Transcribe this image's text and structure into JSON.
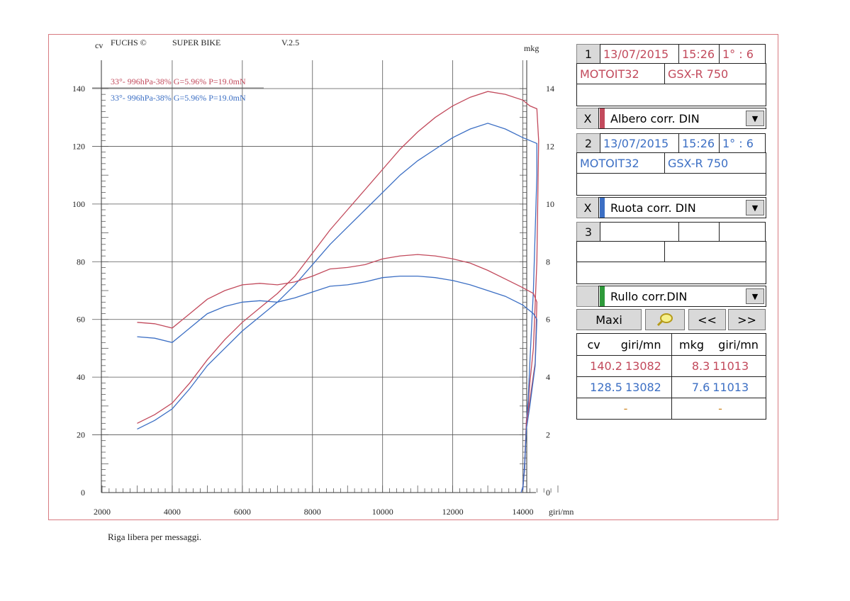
{
  "header": {
    "cv_unit": "cv",
    "brand": "FUCHS ©",
    "program": "SUPER BIKE",
    "version": "V.2.5",
    "right_unit": "mkg"
  },
  "chart_data": {
    "type": "line",
    "xlabel": "giri/mn",
    "ylabel": "cv",
    "y2label": "mkg",
    "xlim": [
      2000,
      15000
    ],
    "ylim": [
      0,
      140
    ],
    "y2lim": [
      0,
      14
    ],
    "x_ticks": [
      "2000",
      "4000",
      "6000",
      "8000",
      "10000",
      "12000",
      "14000"
    ],
    "y_ticks": [
      "0",
      "20",
      "40",
      "60",
      "80",
      "100",
      "120",
      "140"
    ],
    "y2_ticks": [
      "0",
      "2",
      "4",
      "6",
      "8",
      "10",
      "12",
      "14"
    ],
    "grid": true,
    "legend": [
      {
        "label": "33°- 996hPa-38% G=5.96% P=19.0mN",
        "color": "#c24a5c"
      },
      {
        "label": "33°- 996hPa-38% G=5.96% P=19.0mN",
        "color": "#3c6fc4"
      }
    ],
    "series": [
      {
        "color": "#c24a5c",
        "quantity": "cv",
        "axis": "left",
        "points": [
          [
            3000,
            24
          ],
          [
            3500,
            27
          ],
          [
            4000,
            31
          ],
          [
            4500,
            38
          ],
          [
            5000,
            46
          ],
          [
            5500,
            53
          ],
          [
            6000,
            59
          ],
          [
            6500,
            64
          ],
          [
            7000,
            69
          ],
          [
            7500,
            75
          ],
          [
            8000,
            83
          ],
          [
            8500,
            91
          ],
          [
            9000,
            98
          ],
          [
            9500,
            105
          ],
          [
            10000,
            112
          ],
          [
            10500,
            119
          ],
          [
            11000,
            125
          ],
          [
            11500,
            130
          ],
          [
            12000,
            134
          ],
          [
            12500,
            137
          ],
          [
            13000,
            139
          ],
          [
            13500,
            138
          ],
          [
            14000,
            136
          ],
          [
            14200,
            134
          ],
          [
            14400,
            133
          ],
          [
            14450,
            122
          ],
          [
            14400,
            80
          ],
          [
            14300,
            50
          ],
          [
            14200,
            38
          ],
          [
            14150,
            30
          ],
          [
            14100,
            25
          ],
          [
            14050,
            8
          ],
          [
            14000,
            2
          ],
          [
            13950,
            0
          ]
        ]
      },
      {
        "color": "#3c6fc4",
        "quantity": "cv",
        "axis": "left",
        "points": [
          [
            3000,
            22
          ],
          [
            3500,
            25
          ],
          [
            4000,
            29
          ],
          [
            4500,
            36
          ],
          [
            5000,
            44
          ],
          [
            5500,
            50
          ],
          [
            6000,
            56
          ],
          [
            6500,
            61
          ],
          [
            7000,
            66
          ],
          [
            7500,
            72
          ],
          [
            8000,
            79
          ],
          [
            8500,
            86
          ],
          [
            9000,
            92
          ],
          [
            9500,
            98
          ],
          [
            10000,
            104
          ],
          [
            10500,
            110
          ],
          [
            11000,
            115
          ],
          [
            11500,
            119
          ],
          [
            12000,
            123
          ],
          [
            12500,
            126
          ],
          [
            13000,
            128
          ],
          [
            13500,
            126
          ],
          [
            14000,
            123
          ],
          [
            14200,
            122
          ],
          [
            14400,
            121
          ],
          [
            14400,
            110
          ],
          [
            14300,
            70
          ],
          [
            14200,
            45
          ],
          [
            14150,
            32
          ],
          [
            14100,
            24
          ],
          [
            14050,
            8
          ],
          [
            14000,
            2
          ],
          [
            13950,
            0
          ]
        ]
      },
      {
        "color": "#c24a5c",
        "quantity": "mkg",
        "axis": "right",
        "points": [
          [
            3000,
            5.9
          ],
          [
            3500,
            5.85
          ],
          [
            4000,
            5.7
          ],
          [
            4500,
            6.2
          ],
          [
            5000,
            6.7
          ],
          [
            5500,
            7.0
          ],
          [
            6000,
            7.2
          ],
          [
            6500,
            7.25
          ],
          [
            7000,
            7.2
          ],
          [
            7500,
            7.3
          ],
          [
            8000,
            7.5
          ],
          [
            8500,
            7.75
          ],
          [
            9000,
            7.8
          ],
          [
            9500,
            7.9
          ],
          [
            10000,
            8.1
          ],
          [
            10500,
            8.2
          ],
          [
            11000,
            8.25
          ],
          [
            11500,
            8.2
          ],
          [
            12000,
            8.1
          ],
          [
            12500,
            7.95
          ],
          [
            13000,
            7.7
          ],
          [
            13500,
            7.4
          ],
          [
            14000,
            7.1
          ],
          [
            14300,
            6.9
          ],
          [
            14400,
            6.6
          ],
          [
            14350,
            4.5
          ],
          [
            14200,
            3.2
          ],
          [
            14100,
            2.4
          ],
          [
            14050,
            1.0
          ],
          [
            14000,
            0.1
          ]
        ]
      },
      {
        "color": "#3c6fc4",
        "quantity": "mkg",
        "axis": "right",
        "points": [
          [
            3000,
            5.4
          ],
          [
            3500,
            5.35
          ],
          [
            4000,
            5.2
          ],
          [
            4500,
            5.7
          ],
          [
            5000,
            6.2
          ],
          [
            5500,
            6.45
          ],
          [
            6000,
            6.6
          ],
          [
            6500,
            6.65
          ],
          [
            7000,
            6.6
          ],
          [
            7500,
            6.75
          ],
          [
            8000,
            6.95
          ],
          [
            8500,
            7.15
          ],
          [
            9000,
            7.2
          ],
          [
            9500,
            7.3
          ],
          [
            10000,
            7.45
          ],
          [
            10500,
            7.5
          ],
          [
            11000,
            7.5
          ],
          [
            11500,
            7.45
          ],
          [
            12000,
            7.35
          ],
          [
            12500,
            7.2
          ],
          [
            13000,
            7.0
          ],
          [
            13500,
            6.8
          ],
          [
            14000,
            6.5
          ],
          [
            14300,
            6.2
          ],
          [
            14400,
            6.0
          ],
          [
            14350,
            4.4
          ],
          [
            14200,
            3.0
          ],
          [
            14100,
            2.2
          ],
          [
            14050,
            1.0
          ],
          [
            14000,
            0.1
          ]
        ]
      }
    ]
  },
  "panel": {
    "run1": {
      "num": "1",
      "date": "13/07/2015",
      "time": "15:26",
      "gear": "1° : 6",
      "driver": "MOTOIT32",
      "model": "GSX-R 750",
      "close": "X",
      "mode": "Albero corr. DIN",
      "color": "#c24a5c"
    },
    "run2": {
      "num": "2",
      "date": "13/07/2015",
      "time": "15:26",
      "gear": "1° : 6",
      "driver": "MOTOIT32",
      "model": "GSX-R 750",
      "close": "X",
      "mode": "Ruota corr. DIN",
      "color": "#3c6fc4"
    },
    "run3": {
      "num": "3",
      "mode": "Rullo corr.DIN",
      "color": "#2e9a3a"
    },
    "buttons": {
      "maxi": "Maxi",
      "prev": "<<",
      "next": ">>"
    },
    "results": {
      "headers": {
        "cv": "cv",
        "cv_rpm": "giri/mn",
        "mkg": "mkg",
        "mkg_rpm": "giri/mn"
      },
      "row1": {
        "cv": "140.2",
        "cv_rpm": "13082",
        "mkg": "8.3",
        "mkg_rpm": "11013"
      },
      "row2": {
        "cv": "128.5",
        "cv_rpm": "13082",
        "mkg": "7.6",
        "mkg_rpm": "11013"
      },
      "row3": {
        "left": "-",
        "right": "-"
      }
    }
  },
  "footer": {
    "message": "Riga libera per messaggi."
  }
}
